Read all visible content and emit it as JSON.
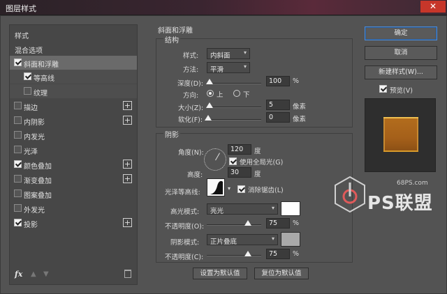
{
  "window": {
    "title": "图层样式",
    "close_glyph": "✕"
  },
  "left_panel": {
    "header_style": "样式",
    "header_blend": "混合选项",
    "items": [
      {
        "label": "斜面和浮雕",
        "checked": true,
        "selected": true
      },
      {
        "label": "等高线",
        "checked": true,
        "sub": true
      },
      {
        "label": "纹理",
        "checked": false,
        "sub": true
      },
      {
        "label": "描边",
        "checked": false,
        "plus": true
      },
      {
        "label": "内阴影",
        "checked": false,
        "plus": true
      },
      {
        "label": "内发光",
        "checked": false
      },
      {
        "label": "光泽",
        "checked": false
      },
      {
        "label": "颜色叠加",
        "checked": true,
        "plus": true
      },
      {
        "label": "渐变叠加",
        "checked": false,
        "plus": true
      },
      {
        "label": "图案叠加",
        "checked": false
      },
      {
        "label": "外发光",
        "checked": false
      },
      {
        "label": "投影",
        "checked": true,
        "plus": true
      }
    ],
    "footer": {
      "fx": "fx",
      "up": "▲",
      "down": "▼"
    }
  },
  "bevel": {
    "section_title": "斜面和浮雕",
    "structure_title": "结构",
    "style_label": "样式:",
    "style_value": "内斜面",
    "method_label": "方法:",
    "method_value": "平滑",
    "depth_label": "深度(D):",
    "depth_value": "100",
    "depth_unit": "%",
    "direction_label": "方向:",
    "direction_up": "上",
    "direction_down": "下",
    "size_label": "大小(Z):",
    "size_value": "5",
    "size_unit": "像素",
    "soften_label": "软化(F):",
    "soften_value": "0",
    "soften_unit": "像素"
  },
  "shading": {
    "title": "阴影",
    "angle_label": "角度(N):",
    "angle_value": "120",
    "angle_unit": "度",
    "global_light_label": "使用全局光(G)",
    "altitude_label": "高度:",
    "altitude_value": "30",
    "altitude_unit": "度",
    "gloss_label": "光泽等高线:",
    "antialias_label": "消除锯齿(L)",
    "highlight_mode_label": "高光模式:",
    "highlight_mode_value": "亮光",
    "highlight_color": "#ffffff",
    "highlight_opacity_label": "不透明度(O):",
    "highlight_opacity_value": "75",
    "highlight_opacity_unit": "%",
    "shadow_mode_label": "阴影模式:",
    "shadow_mode_value": "正片叠底",
    "shadow_color": "#a9a9a9",
    "shadow_opacity_label": "不透明度(C):",
    "shadow_opacity_value": "75",
    "shadow_opacity_unit": "%"
  },
  "bottom_buttons": {
    "make_default": "设置为默认值",
    "reset_default": "复位为默认值"
  },
  "right_panel": {
    "ok": "确定",
    "cancel": "取消",
    "new_style": "新建样式(W)...",
    "preview_label": "预览(V)"
  },
  "watermark": {
    "site": "68PS.com",
    "logo_text": "PS联盟"
  }
}
